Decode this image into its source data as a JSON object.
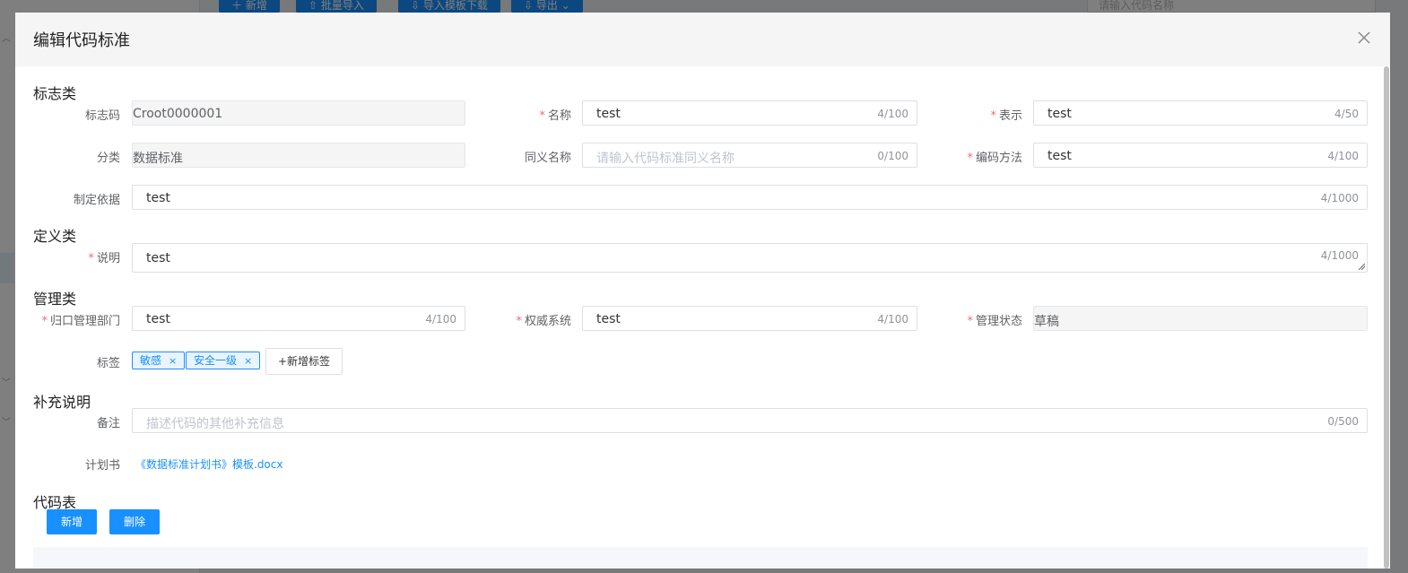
{
  "background": {
    "toolbar": [
      {
        "label": "＋ 新增"
      },
      {
        "label": "⇧ 批量导入"
      },
      {
        "label": "⇩ 导入模板下载"
      },
      {
        "label": "⇩ 导出 ⌄"
      }
    ],
    "search_placeholder": "请输入代码名称"
  },
  "dialog": {
    "title": "编辑代码标准",
    "sections": {
      "identity": "标志类",
      "definition": "定义类",
      "management": "管理类",
      "supplement": "补充说明",
      "code_table": "代码表"
    },
    "fields": {
      "code": {
        "label": "标志码",
        "value": "Croot0000001"
      },
      "name": {
        "label": "名称",
        "value": "test",
        "count": "4/100"
      },
      "display": {
        "label": "表示",
        "value": "test",
        "count": "4/50"
      },
      "category": {
        "label": "分类",
        "value": "数据标准"
      },
      "synonym": {
        "label": "同义名称",
        "placeholder": "请输入代码标准同义名称",
        "count": "0/100"
      },
      "encoding": {
        "label": "编码方法",
        "value": "test",
        "count": "4/100"
      },
      "basis": {
        "label": "制定依据",
        "value": "test",
        "count": "4/1000"
      },
      "description": {
        "label": "说明",
        "value": "test",
        "count": "4/1000"
      },
      "department": {
        "label": "归口管理部门",
        "value": "test",
        "count": "4/100"
      },
      "authority": {
        "label": "权威系统",
        "value": "test",
        "count": "4/100"
      },
      "status": {
        "label": "管理状态",
        "value": "草稿"
      },
      "tags": {
        "label": "标签",
        "items": [
          "敏感",
          "安全一级"
        ],
        "add_label": "+新增标签"
      },
      "remark": {
        "label": "备注",
        "placeholder": "描述代码的其他补充信息",
        "count": "0/500"
      },
      "plan": {
        "label": "计划书",
        "link": "《数据标准计划书》模板.docx"
      }
    },
    "code_table": {
      "add_label": "新增",
      "delete_label": "删除"
    }
  },
  "colors": {
    "primary": "#1890ff",
    "required": "#f56c6c",
    "mask": "rgba(0,0,0,0.5)"
  }
}
